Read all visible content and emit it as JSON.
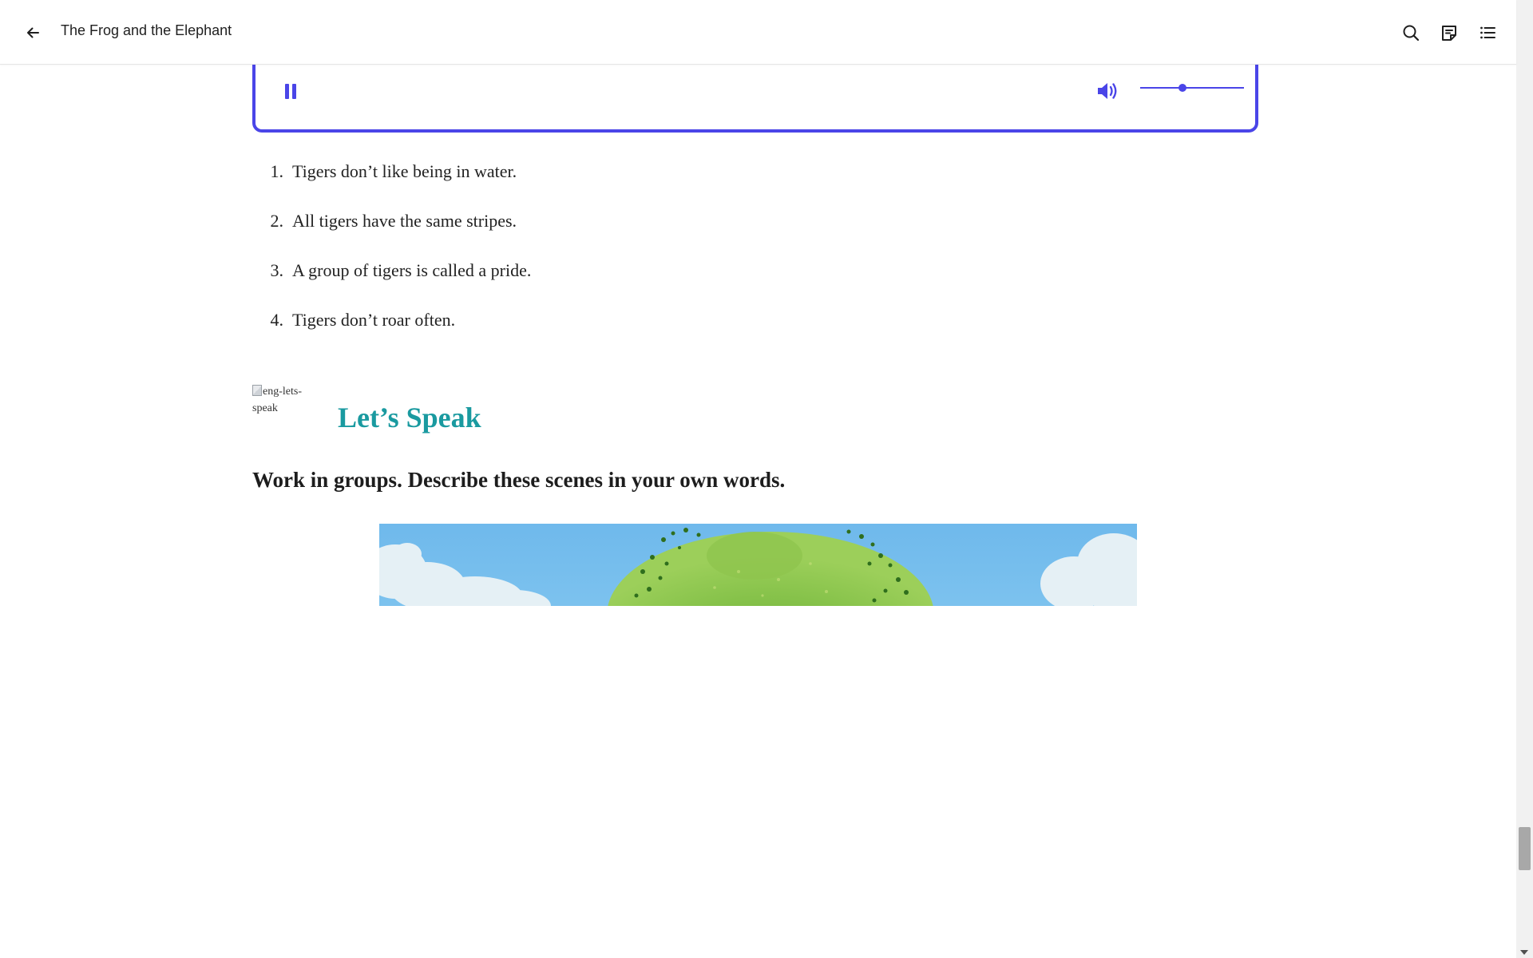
{
  "header": {
    "title": "The Frog and the Elephant",
    "back_icon": "arrow-left-icon",
    "actions": [
      {
        "name": "search",
        "icon": "search-icon"
      },
      {
        "name": "notes",
        "icon": "notes-icon"
      },
      {
        "name": "table-of-contents",
        "icon": "list-icon"
      }
    ]
  },
  "player": {
    "state": "playing",
    "pause_icon": "pause-icon",
    "volume_icon": "volume-icon",
    "volume_level": 0.41,
    "accent_color": "#4a45e8"
  },
  "facts": [
    {
      "number": "1.",
      "text": "Tigers don’t like being in water."
    },
    {
      "number": "2.",
      "text": "All tigers have the same stripes."
    },
    {
      "number": "3.",
      "text": "A group of tigers is called a pride."
    },
    {
      "number": "4.",
      "text": "Tigers don’t roar often."
    }
  ],
  "speak_section": {
    "image_alt": "eng-lets-speak",
    "heading": "Let’s Speak",
    "heading_color": "#1a9aa0",
    "instruction": "Work in groups. Describe these scenes in your own words."
  }
}
